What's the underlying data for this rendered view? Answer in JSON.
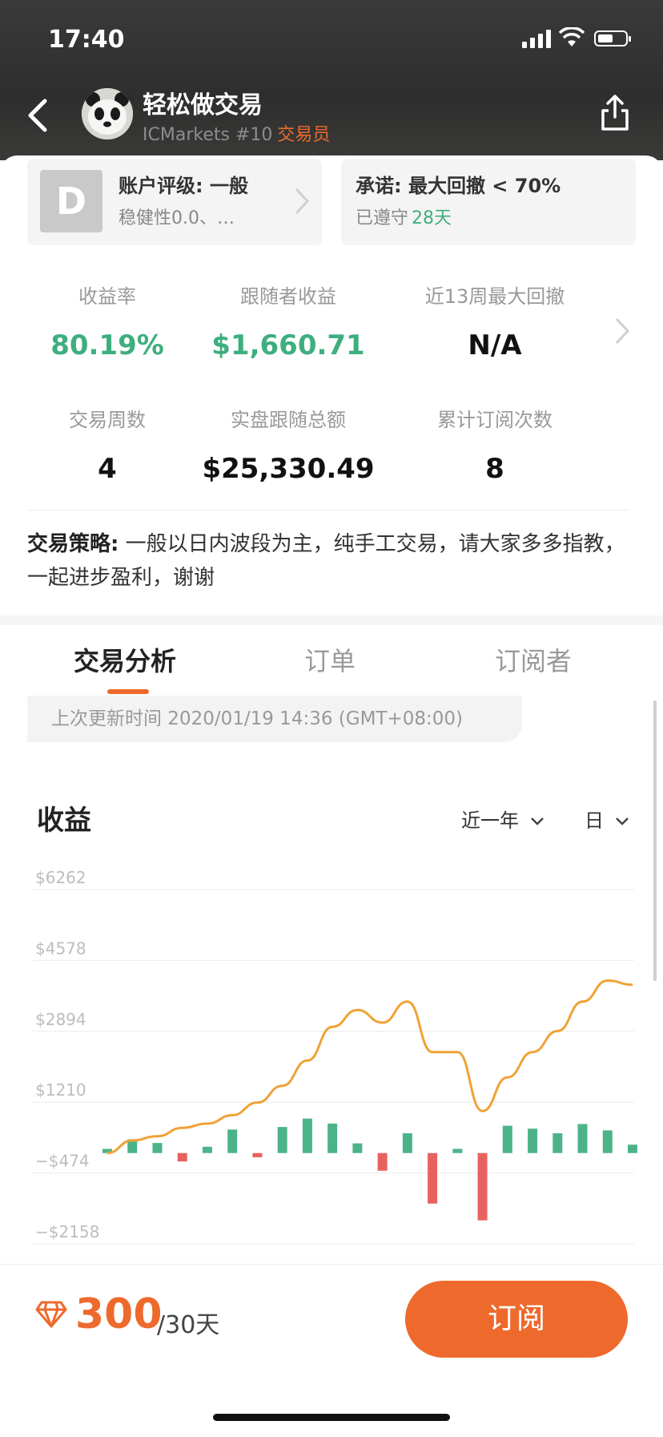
{
  "status": {
    "time": "17:40"
  },
  "profile": {
    "name": "轻松做交易",
    "broker": "ICMarkets #10",
    "role": "交易员"
  },
  "rating": {
    "grade": "D",
    "title": "账户评级: 一般",
    "detail": "稳健性0.0、…"
  },
  "commitment": {
    "title": "承诺: 最大回撤 < 70%",
    "kept_label": "已遵守",
    "kept_days": "28天"
  },
  "stats": [
    {
      "label": "收益率",
      "value": "80.19%",
      "color": "#3fae7e"
    },
    {
      "label": "跟随者收益",
      "value": "$1,660.71",
      "color": "#3fae7e"
    },
    {
      "label": "近13周最大回撤",
      "value": "N/A",
      "color": "#111111"
    },
    {
      "label": "交易周数",
      "value": "4",
      "color": "#111111"
    },
    {
      "label": "实盘跟随总额",
      "value": "$25,330.49",
      "color": "#111111"
    },
    {
      "label": "累计订阅次数",
      "value": "8",
      "color": "#111111"
    }
  ],
  "strategy": {
    "label": "交易策略:",
    "text": "一般以日内波段为主，纯手工交易，请大家多多指教，一起进步盈利，谢谢"
  },
  "tabs": [
    {
      "label": "交易分析",
      "active": true
    },
    {
      "label": "订单",
      "active": false
    },
    {
      "label": "订阅者",
      "active": false
    }
  ],
  "update_text": "上次更新时间 2020/01/19 14:36 (GMT+08:00)",
  "chart_section": {
    "title": "收益",
    "range": "近一年",
    "granularity": "日"
  },
  "chart_data": {
    "type": "bar",
    "y_ticks": [
      "$6262",
      "$4578",
      "$2894",
      "$1210",
      "−$474",
      "−$2158"
    ],
    "ylim": [
      -2158,
      6262
    ],
    "grid": true,
    "bars": [
      100,
      330,
      240,
      -200,
      150,
      560,
      -100,
      620,
      820,
      700,
      230,
      -420,
      470,
      -1200,
      100,
      -1600,
      650,
      580,
      470,
      690,
      540,
      200
    ],
    "line": [
      0,
      300,
      400,
      600,
      700,
      900,
      1200,
      1600,
      2200,
      3000,
      3400,
      3100,
      3600,
      2400,
      2400,
      1000,
      1800,
      2400,
      2900,
      3600,
      4100,
      4000
    ],
    "colors": {
      "positive": "#4cb389",
      "negative": "#e7625e",
      "line": "#f0a236"
    }
  },
  "footer": {
    "price": "300",
    "period": "/30天",
    "subscribe_label": "订阅"
  },
  "theme": {
    "accent": "#ee6a2c",
    "green": "#3fae7e"
  }
}
